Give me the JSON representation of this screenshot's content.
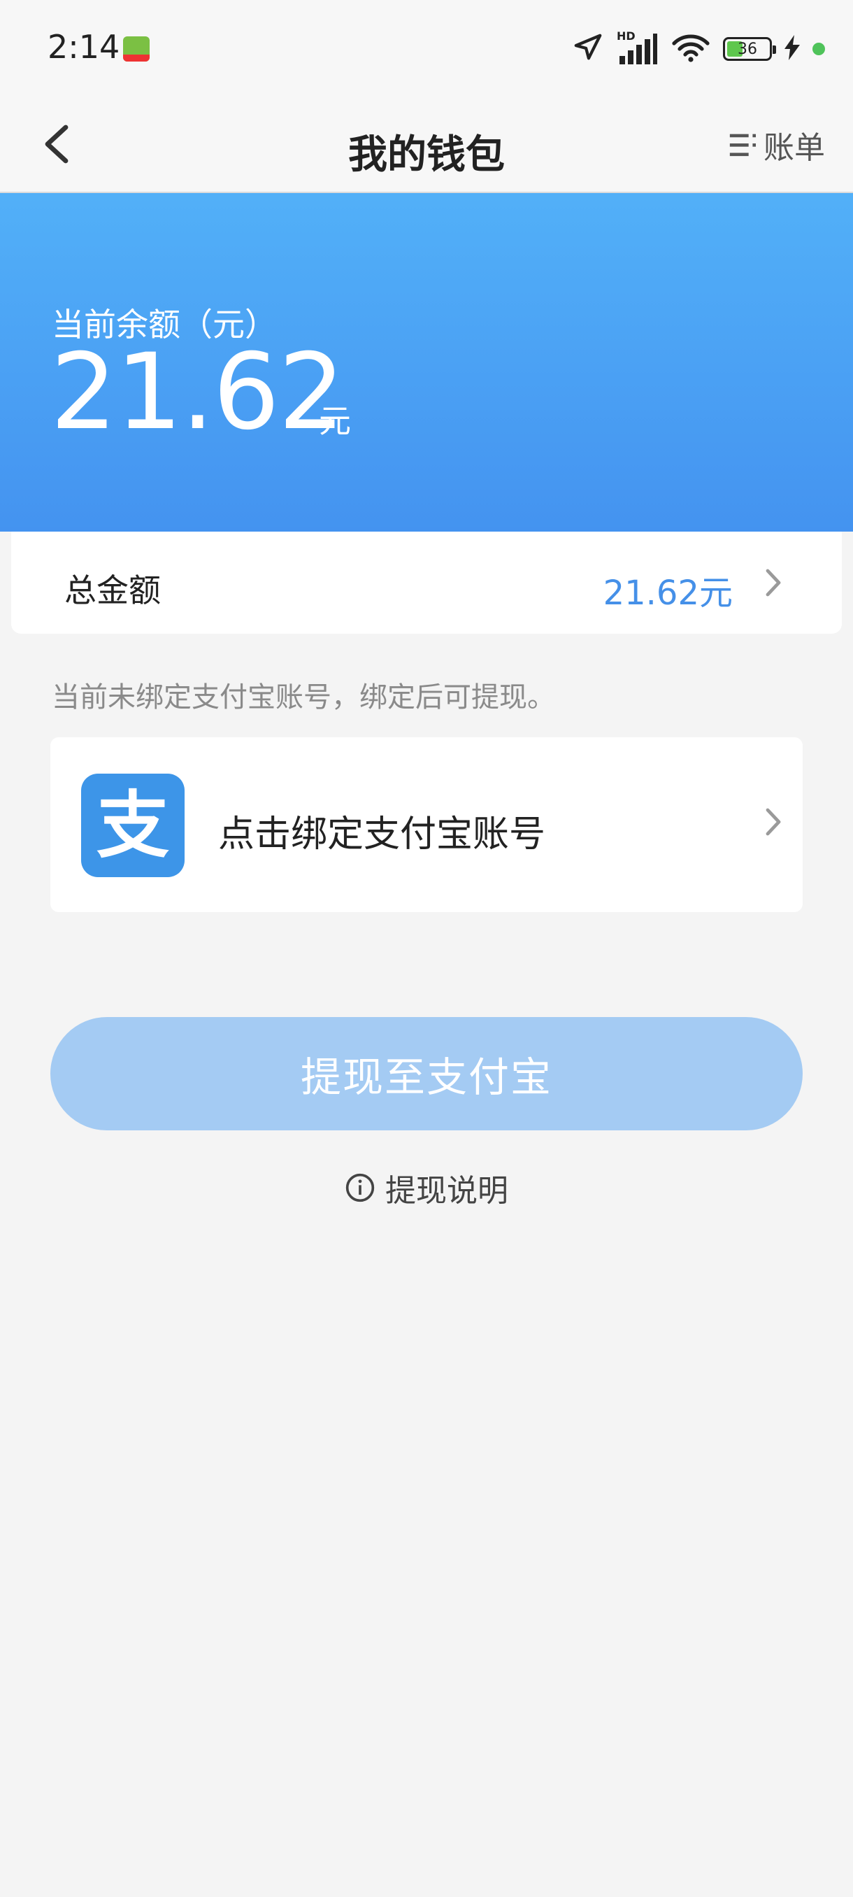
{
  "status_bar": {
    "time": "2:14",
    "network_label": "HD",
    "battery_level": "36",
    "icons": [
      "app-notification-icon",
      "location-icon",
      "signal-icon",
      "wifi-icon",
      "battery-icon",
      "charging-icon",
      "green-dot-indicator"
    ]
  },
  "header": {
    "title": "我的钱包",
    "bill_label": "账单",
    "icons": [
      "back-arrow-icon",
      "list-icon"
    ]
  },
  "balance": {
    "label": "当前余额（元）",
    "amount": "21.62",
    "unit": "元"
  },
  "total": {
    "label": "总金额",
    "value": "21.62元"
  },
  "alipay": {
    "hint": "当前未绑定支付宝账号，绑定后可提现。",
    "bind_label": "点击绑定支付宝账号",
    "logo_glyph": "支"
  },
  "withdraw": {
    "button_label": "提现至支付宝",
    "info_label": "提现说明"
  },
  "colors": {
    "accent_blue": "#4590e8",
    "banner_top": "#52b0f8",
    "banner_bottom": "#4493f0",
    "alipay_blue": "#3d95e8",
    "button_disabled": "#a4cbf3",
    "background": "#f4f4f4"
  }
}
